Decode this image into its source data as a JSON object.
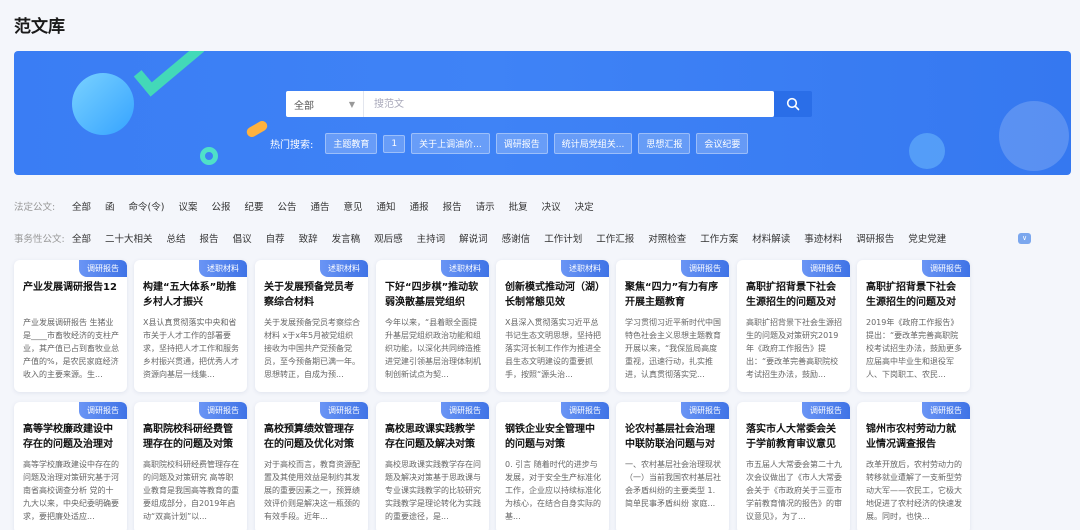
{
  "page": {
    "title": "范文库"
  },
  "search": {
    "select_value": "全部",
    "placeholder": "搜范文"
  },
  "hot": {
    "label": "热门搜索:",
    "tags": [
      "主题教育",
      "1",
      "关于上调油价...",
      "调研报告",
      "统计局党组关...",
      "思想汇报",
      "会议纪要"
    ]
  },
  "filters": {
    "legal": {
      "label": "法定公文:",
      "items": [
        "全部",
        "函",
        "命令(令)",
        "议案",
        "公报",
        "纪要",
        "公告",
        "通告",
        "意见",
        "通知",
        "通报",
        "报告",
        "请示",
        "批复",
        "决议",
        "决定"
      ]
    },
    "affairs": {
      "label": "事务性公文:",
      "items": [
        "全部",
        "二十大相关",
        "总结",
        "报告",
        "倡议",
        "自荐",
        "致辞",
        "发言稿",
        "观后感",
        "主持词",
        "解说词",
        "感谢信",
        "工作计划",
        "工作汇报",
        "对照检查",
        "工作方案",
        "材料解读",
        "事迹材料",
        "调研报告",
        "党史党建"
      ]
    }
  },
  "cards": [
    {
      "tag": "调研报告",
      "title": "产业发展调研报告12",
      "excerpt": "产业发展调研报告 生猪业是____市畜牧经济的支柱产业，其产值已占到畜牧业总产值的%，是农民家庭经济收入的主要来源。生..."
    },
    {
      "tag": "述职材料",
      "title": "构建“五大体系”助推乡村人才振兴",
      "excerpt": "X县认真贯彻落实中央和省市关于人才工作的部署要求，坚持把人才工作和服务乡村振兴贯通，把优秀人才资源向基层一线集..."
    },
    {
      "tag": "述职材料",
      "title": "关于发展预备党员考察综合材料",
      "excerpt": "关于发展预备党员考察综合材料 x于x年5月被党组织接收为中国共产党预备党员，至今预备期已满一年。思想转正，自成为预..."
    },
    {
      "tag": "述职材料",
      "title": "下好“四步棋”推动软弱涣散基层党组织整...",
      "excerpt": "今年以来，“县着眼全面提升基层党组织政治功能和组织功能，以深化共同缔造推进党建引领基层治理体制机制创新试点为契..."
    },
    {
      "tag": "述职材料",
      "title": "创新模式推动河（湖）长制常態见效",
      "excerpt": "X县深入贯彻落实习近平总书记生态文明思想，坚持把落实河长制工作作为推进全县生态文明建设的重要抓手，按照“源头治..."
    },
    {
      "tag": "调研报告",
      "title": "聚焦“四力”有力有序开展主题教育",
      "excerpt": "学习贯彻习近平新时代中国特色社会主义思想主题教育开展以来，“我保监局高度重视，迅速行动，扎实推进，认真贯彻落实党..."
    },
    {
      "tag": "调研报告",
      "title": "高职扩招背景下社会生源招生的问题及对策...",
      "excerpt": "高职扩招背景下社会生源招生的问题及对策研究2019年《政府工作报告》提出：“要改革完善高职院校考试招生办法，鼓励..."
    },
    {
      "tag": "调研报告",
      "title": "高职扩招背景下社会生源招生的问题及对策...",
      "excerpt": "2019年《政府工作报告》提出：“要改革完善高职院校考试招生办法，鼓励更多应届高中毕业生和退役军人、下岗职工、农民..."
    },
    {
      "tag": "调研报告",
      "title": "高等学校廉政建设中存在的问题及治理对策...",
      "excerpt": "高等学校廉政建设中存在的问题及治理对策研究基于河南省高校调查分析 党的十九大以来，中央纪委明确要求，要把廉处适应..."
    },
    {
      "tag": "调研报告",
      "title": "高职院校科研经费管理存在的问题及对策研究",
      "excerpt": "高职院校科研经费管理存在的问题及对策研究 高等职业教育是我国高等教育的重要组成部分，自2019年启动“双高计划”以..."
    },
    {
      "tag": "调研报告",
      "title": "高校预算绩效管理存在的问题及优化对策探析",
      "excerpt": "对于高校而言，教育资源配置及其使用效益是制约其发展的重要因素之一，预算绩效评价则是解决这一瓶颈的有效手段。近年..."
    },
    {
      "tag": "调研报告",
      "title": "高校思政课实践教学存在问题及解决对策基...",
      "excerpt": "高校思政课实践教学存在问题及解决对策基于思政课与专业课实践教学的比较研究 实践教学是理论转化为实践的重要途径，是..."
    },
    {
      "tag": "调研报告",
      "title": "钢铁企业安全管理中的问题与对策",
      "excerpt": "0.        引言 随着时代的进步与发展，对于安全生产标准化工作，企业应以持续标准化为核心，在结合自身实际的基..."
    },
    {
      "tag": "调研报告",
      "title": "论农村基层社会治理中联防联治问题与对策",
      "excerpt": "一、农村基层社会治理现状（一）当前我国农村基层社会矛盾纠纷的主要类型 1.        简单民事矛盾纠纷 家庭..."
    },
    {
      "tag": "调研报告",
      "title": "落实市人大常委会关于学前教育审议意见的...",
      "excerpt": "市五届人大常委会第二十九次会议做出了《市人大常委会关于《市政府关于三亚市学前教育情况的报告》的审议意见》，为了..."
    },
    {
      "tag": "调研报告",
      "title": "锦州市农村劳动力就业情况调查报告",
      "excerpt": "改革开放后，农村劳动力的转移就业遭解了一支新型劳动大军——农民工，它极大地促进了农村经济的快速发展。同时，也快..."
    }
  ]
}
